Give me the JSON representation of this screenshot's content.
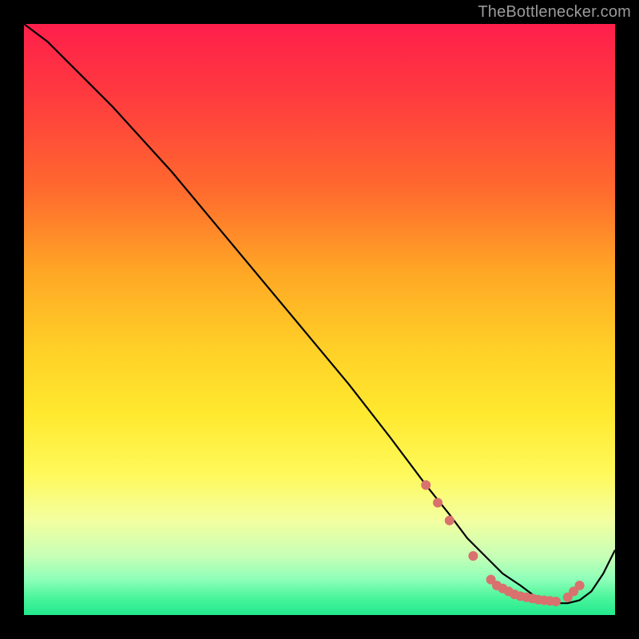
{
  "attribution": "TheBottlenecker.com",
  "chart_data": {
    "type": "line",
    "title": "",
    "xlabel": "",
    "ylabel": "",
    "xlim": [
      0,
      100
    ],
    "ylim": [
      0,
      100
    ],
    "series": [
      {
        "name": "curve",
        "x": [
          0,
          4,
          8,
          15,
          25,
          35,
          45,
          55,
          62,
          68,
          72,
          75,
          78,
          81,
          84,
          86,
          88,
          90,
          92,
          94,
          96,
          98,
          100
        ],
        "y": [
          100,
          97,
          93,
          86,
          75,
          63,
          51,
          39,
          30,
          22,
          17,
          13,
          10,
          7,
          5,
          3.5,
          2.5,
          2,
          2,
          2.5,
          4,
          7,
          11
        ]
      }
    ],
    "markers": [
      {
        "x": 68,
        "y": 22
      },
      {
        "x": 70,
        "y": 19
      },
      {
        "x": 72,
        "y": 16
      },
      {
        "x": 76,
        "y": 10
      },
      {
        "x": 79,
        "y": 6
      },
      {
        "x": 80,
        "y": 5
      },
      {
        "x": 81,
        "y": 4.5
      },
      {
        "x": 82,
        "y": 4
      },
      {
        "x": 83,
        "y": 3.5
      },
      {
        "x": 84,
        "y": 3.2
      },
      {
        "x": 85,
        "y": 3
      },
      {
        "x": 86,
        "y": 2.8
      },
      {
        "x": 87,
        "y": 2.6
      },
      {
        "x": 88,
        "y": 2.5
      },
      {
        "x": 89,
        "y": 2.4
      },
      {
        "x": 90,
        "y": 2.3
      },
      {
        "x": 92,
        "y": 3
      },
      {
        "x": 93,
        "y": 4
      },
      {
        "x": 94,
        "y": 5
      }
    ],
    "colors": {
      "line": "#000000",
      "marker": "#d9716e"
    }
  }
}
